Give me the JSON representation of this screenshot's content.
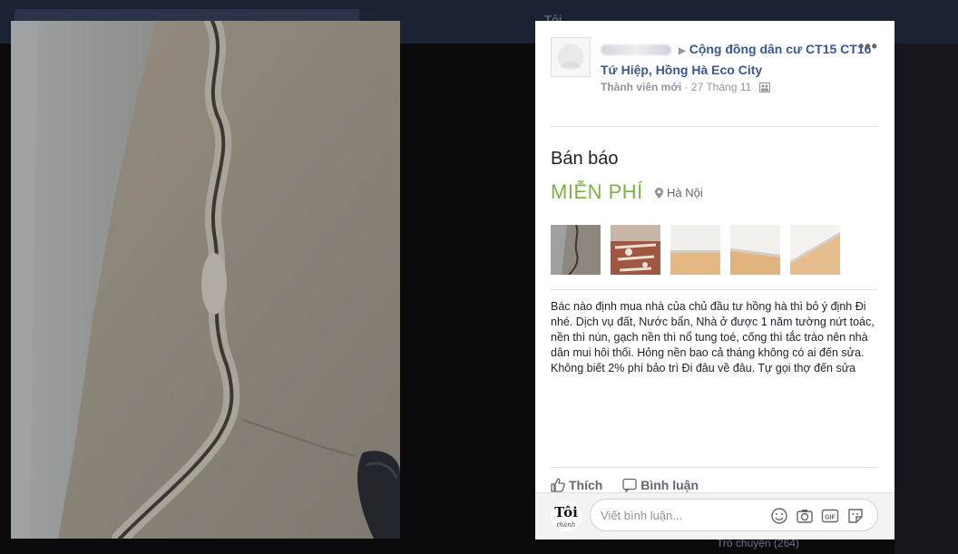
{
  "background": {
    "top_nav_label": "Tôi",
    "chat_label": "Trò chuyện (264)"
  },
  "post": {
    "author_name_blurred": true,
    "group_name": "Cộng đồng dân cư CT15 CT16 Tứ Hiệp, Hồng Hà Eco City",
    "member_role": "Thành viên mới",
    "separator": " · ",
    "date": "27 Tháng 11",
    "more_label": "•••"
  },
  "listing": {
    "title": "Bán báo",
    "price": "MIỄN PHÍ",
    "location": "Hà Nội",
    "thumbnails": [
      "crack-photo",
      "tiled-floor-photo",
      "wall-floor-photo",
      "wall-floor-photo",
      "wall-floor-photo"
    ],
    "description": "Bác nào định mua nhà của chủ đầu tư hồng hà thì bỏ ý định Đi nhé. Dịch vụ đất, Nước bẩn, Nhà ở được 1 năm tường nứt toác, nền thì nún, gạch nền thì nổ tung toé, cống thì tắc trào nên nhà dân mui hôi thối. Hỏng nền bao cả tháng không có ai đến sửa. Không biết 2% phí bảo trì Đi đâu về đâu. Tự gọi thợ đến sửa"
  },
  "actions": {
    "like": "Thích",
    "comment": "Bình luận"
  },
  "comment_box": {
    "logo_text": "Tôi",
    "logo_subtext": "thành",
    "placeholder": "Viết bình luận...",
    "tools": [
      "emoji-icon",
      "camera-icon",
      "gif-icon",
      "sticker-icon"
    ]
  },
  "colors": {
    "link": "#365899",
    "price": "#7cb342",
    "meta": "#90949c",
    "backdrop": "#0b0b0d"
  }
}
